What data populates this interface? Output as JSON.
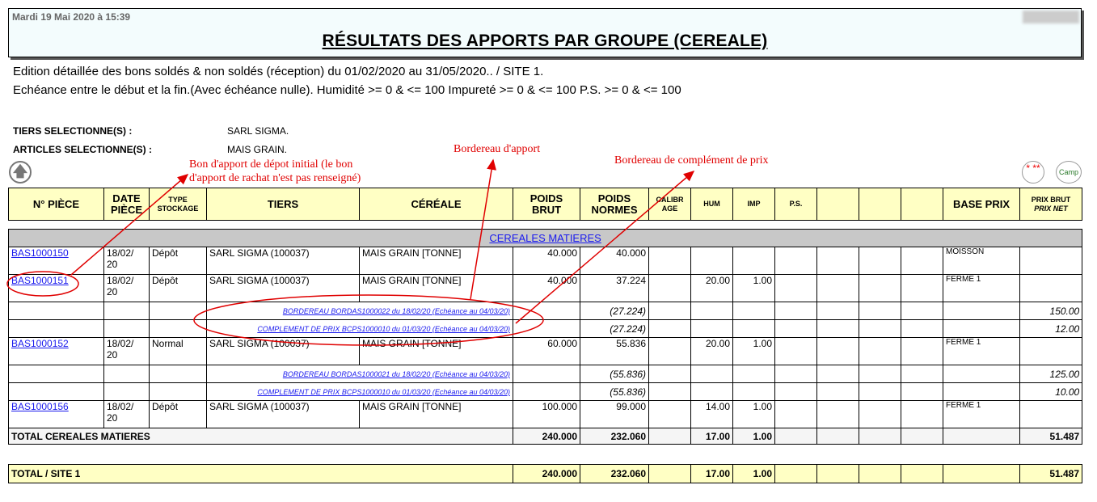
{
  "header": {
    "print_date": "Mardi 19 Mai 2020 à 15:39",
    "title": "RÉSULTATS DES APPORTS PAR GROUPE (CEREALE)"
  },
  "criteria": {
    "line1": "Edition détaillée des bons soldés & non soldés (réception) du 01/02/2020 au 31/05/2020.. / SITE 1.",
    "line2": "Echéance entre le début et la fin.(Avec échéance nulle). Humidité >= 0 & <= 100 Impureté >= 0 & <= 100 P.S. >= 0 & <= 100"
  },
  "selection": {
    "tiers_label": "TIERS SELECTIONNE(S) :",
    "tiers_value": "SARL SIGMA.",
    "articles_label": "ARTICLES SELECTIONNE(S) :",
    "articles_value": "MAIS GRAIN."
  },
  "annotations": {
    "bon_depot_1": "Bon d'apport de dépot initial (le bon",
    "bon_depot_2": "d'apport de rachat n'est pas renseigné)",
    "bordereau": "Bordereau d'apport",
    "complement": "Bordereau de complément de prix"
  },
  "buttons": {
    "up": "🡅",
    "star": "* **",
    "camp": "Camp"
  },
  "columns": {
    "piece": "N° PIÈCE",
    "date_1": "DATE",
    "date_2": "PIÈCE",
    "type_1": "TYPE",
    "type_2": "STOCKAGE",
    "tiers": "TIERS",
    "cereale": "CÉRÉALE",
    "poids_brut_1": "POIDS",
    "poids_brut_2": "BRUT",
    "poids_normes_1": "POIDS",
    "poids_normes_2": "NORMES",
    "calib_1": "CALIBR",
    "calib_2": "AGE",
    "hum": "HUM",
    "imp": "IMP",
    "ps": "P.S.",
    "base_prix": "BASE PRIX",
    "prix_brut": "PRIX BRUT",
    "prix_net": "PRIX NET"
  },
  "group": {
    "name": "CEREALES MATIERES",
    "rows": [
      {
        "piece": "BAS1000150",
        "date_a": "18/02/",
        "date_b": "20",
        "type": "Dépôt",
        "tiers": "SARL SIGMA (100037)",
        "cereale": "MAIS GRAIN [TONNE]",
        "poids_brut": "40.000",
        "poids_normes": "40.000",
        "hum": "",
        "imp": "",
        "base": "MOISSON"
      },
      {
        "piece": "BAS1000151",
        "date_a": "18/02/",
        "date_b": "20",
        "type": "Dépôt",
        "tiers": "SARL SIGMA (100037)",
        "cereale": "MAIS GRAIN [TONNE]",
        "poids_brut": "40.000",
        "poids_normes": "37.224",
        "hum": "20.00",
        "imp": "1.00",
        "base": "FERME 1",
        "subs": [
          {
            "label": "BORDEREAU BORDAS1000022 du 18/02/20 (Echéance au 04/03/20)",
            "qty": "(27.224)",
            "price": "150.00"
          },
          {
            "label": "COMPLEMENT DE PRIX BCPS1000010 du 01/03/20 (Echéance au 04/03/20)",
            "qty": "(27.224)",
            "price": "12.00"
          }
        ]
      },
      {
        "piece": "BAS1000152",
        "date_a": "18/02/",
        "date_b": "20",
        "type": "Normal",
        "tiers": "SARL SIGMA (100037)",
        "cereale": "MAIS GRAIN [TONNE]",
        "poids_brut": "60.000",
        "poids_normes": "55.836",
        "hum": "20.00",
        "imp": "1.00",
        "base": "FERME 1",
        "subs": [
          {
            "label": "BORDEREAU BORDAS1000021 du 18/02/20 (Echéance au 04/03/20)",
            "qty": "(55.836)",
            "price": "125.00"
          },
          {
            "label": "COMPLEMENT DE PRIX BCPS1000010 du 01/03/20 (Echéance au 04/03/20)",
            "qty": "(55.836)",
            "price": "10.00"
          }
        ]
      },
      {
        "piece": "BAS1000156",
        "date_a": "18/02/",
        "date_b": "20",
        "type": "Dépôt",
        "tiers": "SARL SIGMA (100037)",
        "cereale": "MAIS GRAIN [TONNE]",
        "poids_brut": "100.000",
        "poids_normes": "99.000",
        "hum": "14.00",
        "imp": "1.00",
        "base": "FERME 1"
      }
    ],
    "total": {
      "label": "TOTAL CEREALES MATIERES",
      "poids_brut": "240.000",
      "poids_normes": "232.060",
      "hum": "17.00",
      "imp": "1.00",
      "prix": "51.487"
    }
  },
  "grand_total": {
    "label": "TOTAL / SITE 1",
    "poids_brut": "240.000",
    "poids_normes": "232.060",
    "hum": "17.00",
    "imp": "1.00",
    "prix": "51.487"
  },
  "colors": {
    "header_bg": "#ffffc4",
    "group_bg": "#c8c8c8",
    "link": "#1a1aee",
    "annotation": "#e00000"
  }
}
